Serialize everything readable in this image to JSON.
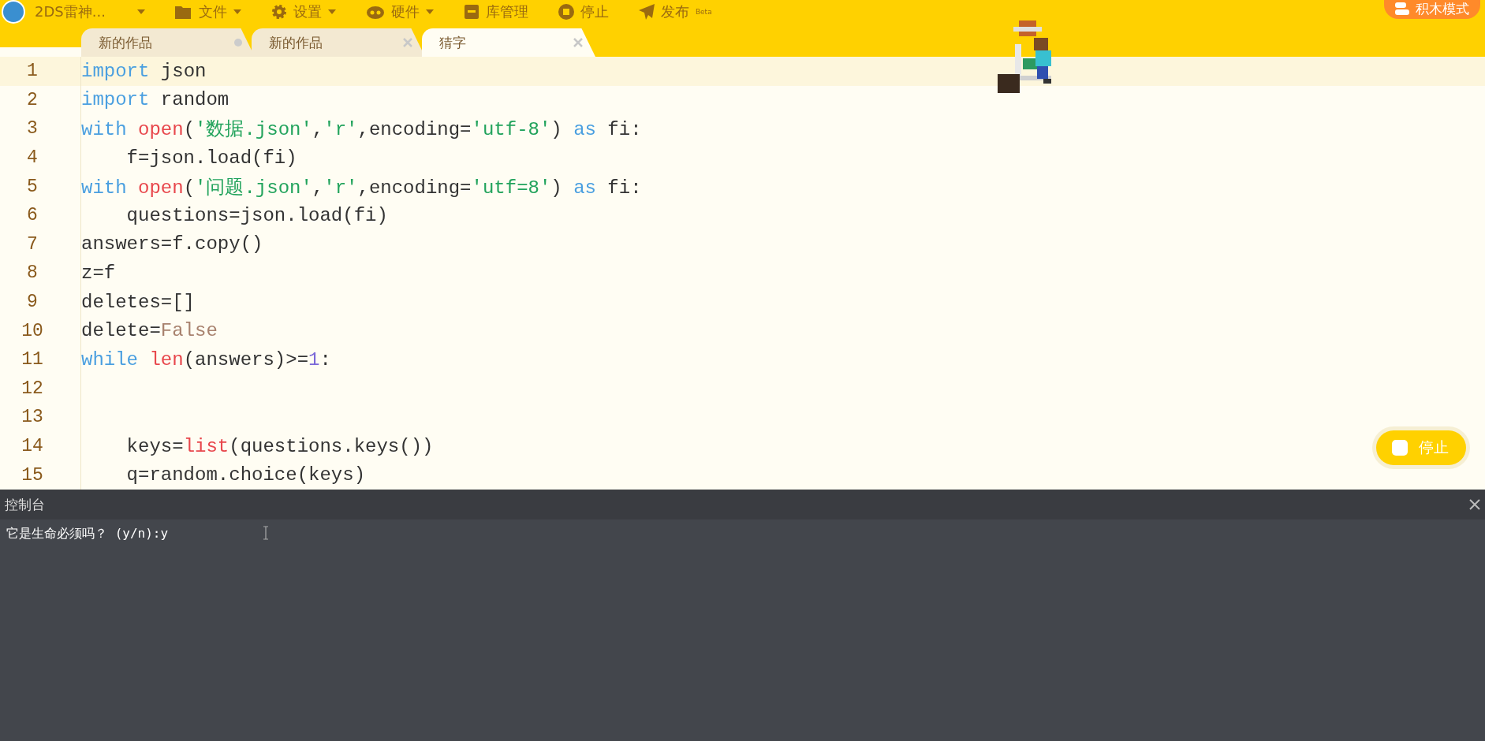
{
  "top_bar": {
    "user": {
      "name": "2DS雷神..."
    },
    "menus": [
      {
        "label": "文件",
        "kind": "folder",
        "dropdown": true
      },
      {
        "label": "设置",
        "kind": "gear",
        "dropdown": true
      },
      {
        "label": "硬件",
        "kind": "hardware",
        "dropdown": true
      },
      {
        "label": "库管理",
        "kind": "box",
        "dropdown": false
      },
      {
        "label": "停止",
        "kind": "stop",
        "dropdown": false
      },
      {
        "label": "发布",
        "kind": "plane",
        "dropdown": false,
        "badge": "Beta"
      }
    ],
    "mode_button": "积木模式"
  },
  "tabs": [
    {
      "label": "新的作品",
      "selected": false,
      "modified": true
    },
    {
      "label": "新的作品",
      "selected": false,
      "modified": false
    },
    {
      "label": "猜字",
      "selected": true,
      "modified": false
    }
  ],
  "editor": {
    "lines": [
      {
        "number": "1",
        "current": true,
        "tokens": [
          {
            "t": "import",
            "kind": "keyword"
          },
          {
            "t": " json",
            "kind": "plain"
          }
        ]
      },
      {
        "number": "2",
        "current": false,
        "tokens": [
          {
            "t": "import",
            "kind": "keyword"
          },
          {
            "t": " random",
            "kind": "plain"
          }
        ]
      },
      {
        "number": "3",
        "current": false,
        "tokens": [
          {
            "t": "with",
            "kind": "keyword"
          },
          {
            "t": " open",
            "kind": "builtin"
          },
          {
            "t": "(",
            "kind": "plain"
          },
          {
            "t": "'数据.json'",
            "kind": "string"
          },
          {
            "t": ",",
            "kind": "plain"
          },
          {
            "t": "'r'",
            "kind": "string"
          },
          {
            "t": ",encoding=",
            "kind": "plain"
          },
          {
            "t": "'utf-8'",
            "kind": "string"
          },
          {
            "t": ") ",
            "kind": "plain"
          },
          {
            "t": "as",
            "kind": "keyword"
          },
          {
            "t": " fi:",
            "kind": "plain"
          }
        ]
      },
      {
        "number": "4",
        "current": false,
        "tokens": [
          {
            "t": "    f=json.load(fi)",
            "kind": "plain"
          }
        ]
      },
      {
        "number": "5",
        "current": false,
        "tokens": [
          {
            "t": "with",
            "kind": "keyword"
          },
          {
            "t": " open",
            "kind": "builtin"
          },
          {
            "t": "(",
            "kind": "plain"
          },
          {
            "t": "'问题.json'",
            "kind": "string"
          },
          {
            "t": ",",
            "kind": "plain"
          },
          {
            "t": "'r'",
            "kind": "string"
          },
          {
            "t": ",encoding=",
            "kind": "plain"
          },
          {
            "t": "'utf=8'",
            "kind": "string"
          },
          {
            "t": ") ",
            "kind": "plain"
          },
          {
            "t": "as",
            "kind": "keyword"
          },
          {
            "t": " fi:",
            "kind": "plain"
          }
        ]
      },
      {
        "number": "6",
        "current": false,
        "tokens": [
          {
            "t": "    questions=json.load(fi)",
            "kind": "plain"
          }
        ]
      },
      {
        "number": "7",
        "current": false,
        "tokens": [
          {
            "t": "answers=f.copy()",
            "kind": "plain"
          }
        ]
      },
      {
        "number": "8",
        "current": false,
        "tokens": [
          {
            "t": "z=f",
            "kind": "plain"
          }
        ]
      },
      {
        "number": "9",
        "current": false,
        "tokens": [
          {
            "t": "deletes=[]",
            "kind": "plain"
          }
        ]
      },
      {
        "number": "10",
        "current": false,
        "tokens": [
          {
            "t": "delete=",
            "kind": "plain"
          },
          {
            "t": "False",
            "kind": "constant"
          }
        ]
      },
      {
        "number": "11",
        "current": false,
        "tokens": [
          {
            "t": "while",
            "kind": "keyword"
          },
          {
            "t": " len",
            "kind": "builtin"
          },
          {
            "t": "(answers)>=",
            "kind": "plain"
          },
          {
            "t": "1",
            "kind": "number"
          },
          {
            "t": ":",
            "kind": "plain"
          }
        ]
      },
      {
        "number": "12",
        "current": false
      },
      {
        "number": "13",
        "current": false
      },
      {
        "number": "14",
        "current": false,
        "tokens": [
          {
            "t": "    keys=",
            "kind": "plain"
          },
          {
            "t": "list",
            "kind": "builtin"
          },
          {
            "t": "(questions.keys())",
            "kind": "plain"
          }
        ]
      },
      {
        "number": "15",
        "current": false,
        "tokens": [
          {
            "t": "    q=random.choice(keys)",
            "kind": "plain"
          }
        ]
      }
    ]
  },
  "stop_button": "停止",
  "console": {
    "title": "控制台",
    "output": "它是生命必须吗？ (y/n):y"
  }
}
